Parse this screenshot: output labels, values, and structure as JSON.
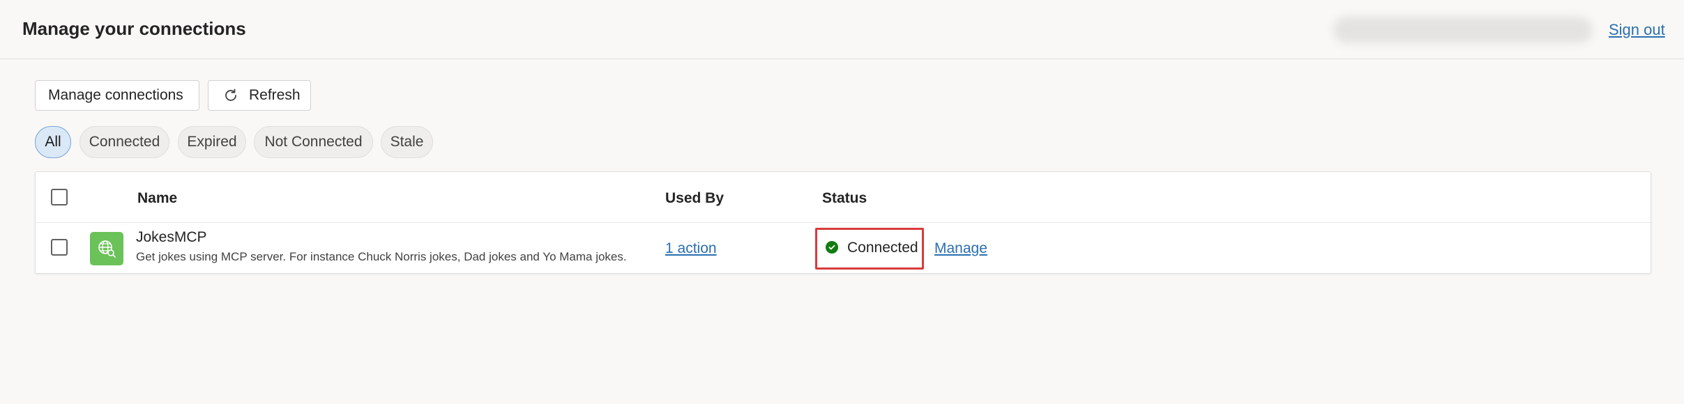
{
  "header": {
    "title": "Manage your connections",
    "sign_out": "Sign out"
  },
  "toolbar": {
    "manage_label": "Manage connections",
    "refresh_label": "Refresh",
    "refresh_icon": "refresh-icon"
  },
  "filters": {
    "selected": "All",
    "items": [
      "All",
      "Connected",
      "Expired",
      "Not Connected",
      "Stale"
    ]
  },
  "table": {
    "columns": [
      "Name",
      "Used By",
      "Status"
    ],
    "rows": [
      {
        "name": "JokesMCP",
        "description": "Get jokes using MCP server. For instance Chuck Norris jokes, Dad jokes and Yo Mama jokes.",
        "icon": "globe-icon",
        "used_by": "1 action",
        "status": "Connected",
        "status_color": "#107c10",
        "action": "Manage"
      }
    ]
  },
  "colors": {
    "link": "#2a6fb0",
    "highlight_box": "#d83b3b",
    "app_icon_bg": "#6ac259"
  }
}
